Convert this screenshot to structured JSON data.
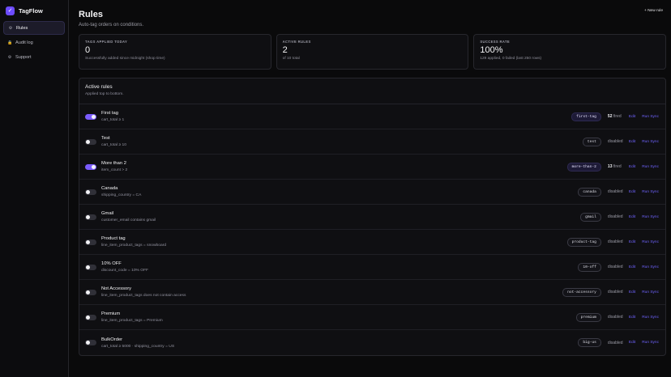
{
  "sidebar": {
    "brand": "TagFlow",
    "items": [
      {
        "label": "Rules",
        "icon": "gear-icon"
      },
      {
        "label": "Audit log",
        "icon": "lock-icon"
      },
      {
        "label": "Support",
        "icon": "settings-icon"
      }
    ]
  },
  "header": {
    "title": "Rules",
    "subtitle": "Auto-tag orders on conditions.",
    "new_rule": "+ New rule"
  },
  "stats": [
    {
      "label": "TAGS APPLIED TODAY",
      "value": "0",
      "note": "Successfully added since midnight (shop time)"
    },
    {
      "label": "ACTIVE RULES",
      "value": "2",
      "note": "of 10 total"
    },
    {
      "label": "SUCCESS RATE",
      "value": "100%",
      "note": "129 applied, 0 failed (last 250 rows)"
    }
  ],
  "rules_panel": {
    "title": "Active rules",
    "subtitle": "Applied top to bottom.",
    "edit_label": "Edit",
    "run_label": "Run Sync",
    "fired_suffix": "fired",
    "disabled_label": "disabled",
    "rows": [
      {
        "name": "First tag",
        "condition": "cart_total ≥ 1",
        "tag": "first-tag",
        "enabled": true,
        "fired": "52"
      },
      {
        "name": "Test",
        "condition": "cart_total ≥ 10",
        "tag": "test",
        "enabled": false,
        "fired": ""
      },
      {
        "name": "More than 2",
        "condition": "item_count > 2",
        "tag": "more-than-2",
        "enabled": true,
        "fired": "13"
      },
      {
        "name": "Canada",
        "condition": "shipping_country = CA",
        "tag": "canada",
        "enabled": false,
        "fired": ""
      },
      {
        "name": "Gmail",
        "condition": "customer_email contains gmail",
        "tag": "gmail",
        "enabled": false,
        "fired": ""
      },
      {
        "name": "Product tag",
        "condition": "line_item_product_tags = snowboard",
        "tag": "product-tag",
        "enabled": false,
        "fired": ""
      },
      {
        "name": "10% OFF",
        "condition": "discount_code = 10% OFF",
        "tag": "10-off",
        "enabled": false,
        "fired": ""
      },
      {
        "name": "Not Accessory",
        "condition": "line_item_product_tags does not contain access",
        "tag": "not-accessory",
        "enabled": false,
        "fired": ""
      },
      {
        "name": "Premium",
        "condition": "line_item_product_tags = Premium",
        "tag": "premium",
        "enabled": false,
        "fired": ""
      },
      {
        "name": "BulkOrder",
        "condition": "cart_total ≥ 5000 · shipping_country = US",
        "tag": "big-us",
        "enabled": false,
        "fired": ""
      }
    ]
  },
  "colors": {
    "accent": "#7b5cff",
    "link": "#6f63ff",
    "background": "#0a0a0b"
  }
}
